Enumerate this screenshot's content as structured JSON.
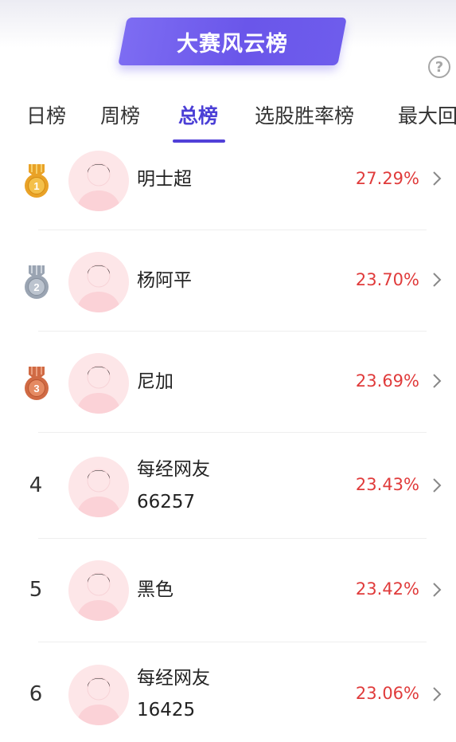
{
  "header": {
    "title": "大赛风云榜",
    "help_icon": "question-circle-icon"
  },
  "tabs": [
    {
      "label": "日榜",
      "active": false
    },
    {
      "label": "周榜",
      "active": false
    },
    {
      "label": "总榜",
      "active": true
    },
    {
      "label": "选股胜率榜",
      "active": false
    },
    {
      "label": "最大回",
      "active": false
    }
  ],
  "colors": {
    "accent": "#5140d8",
    "rate": "#e03b3b",
    "gold": "#e9a227",
    "silver": "#9aa4b2",
    "bronze": "#d06a44"
  },
  "rankings": [
    {
      "rank": "1",
      "medal": "gold",
      "name_line1": "明士超",
      "name_line2": "",
      "rate": "27.29%"
    },
    {
      "rank": "2",
      "medal": "silver",
      "name_line1": "杨阿平",
      "name_line2": "",
      "rate": "23.70%"
    },
    {
      "rank": "3",
      "medal": "bronze",
      "name_line1": "尼加",
      "name_line2": "",
      "rate": "23.69%"
    },
    {
      "rank": "4",
      "medal": "",
      "name_line1": "每经网友",
      "name_line2": "66257",
      "rate": "23.43%"
    },
    {
      "rank": "5",
      "medal": "",
      "name_line1": "黑色",
      "name_line2": "",
      "rate": "23.42%"
    },
    {
      "rank": "6",
      "medal": "",
      "name_line1": "每经网友",
      "name_line2": "16425",
      "rate": "23.06%"
    }
  ]
}
